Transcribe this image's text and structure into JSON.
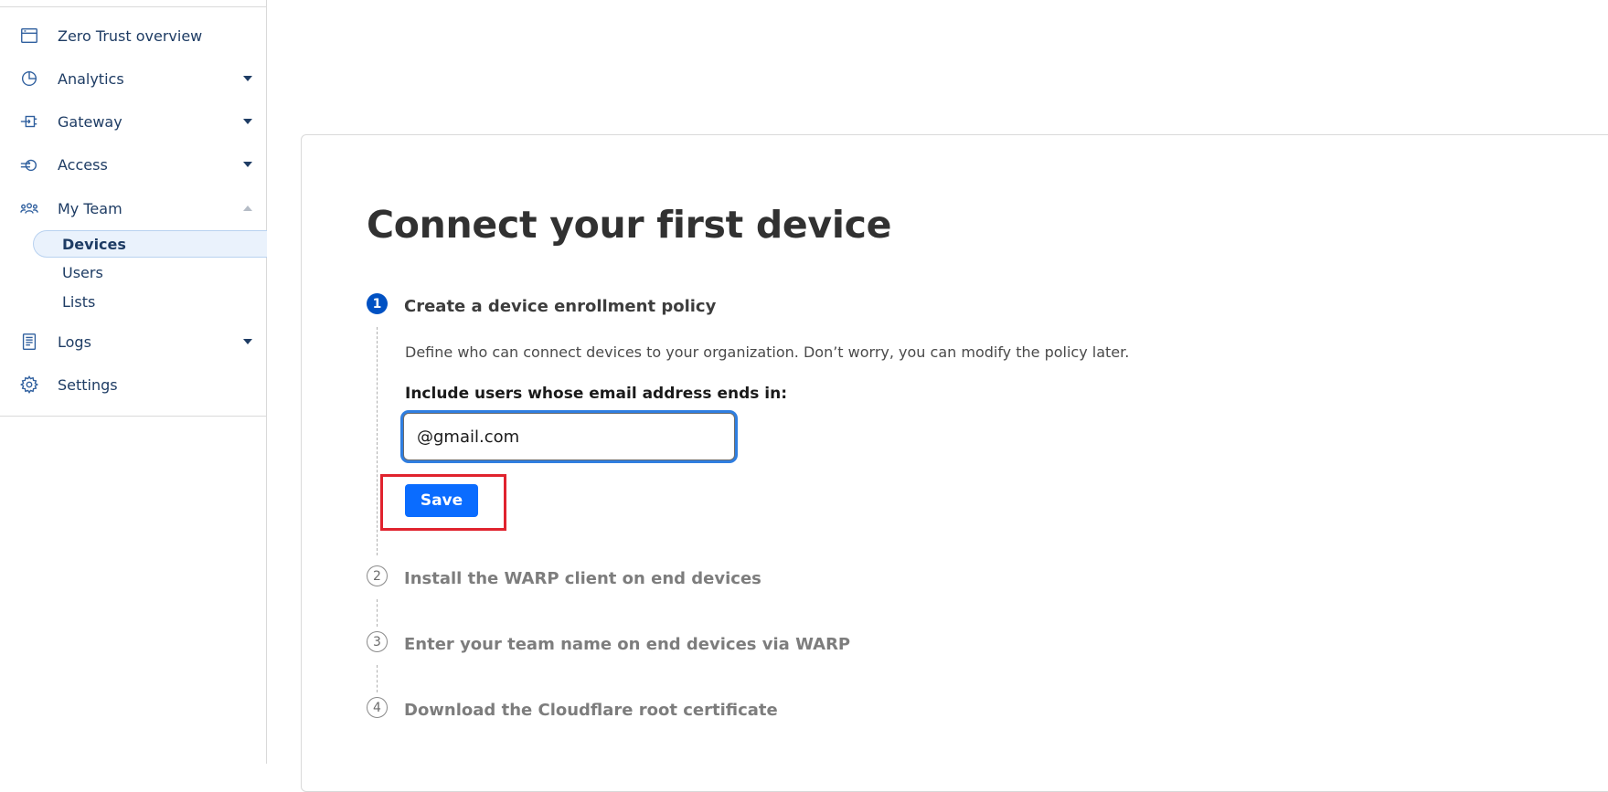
{
  "sidebar": {
    "items": [
      {
        "label": "Zero Trust overview",
        "icon": "browser-window-icon"
      },
      {
        "label": "Analytics",
        "icon": "pie-chart-icon"
      },
      {
        "label": "Gateway",
        "icon": "gateway-icon"
      },
      {
        "label": "Access",
        "icon": "access-icon"
      },
      {
        "label": "My Team",
        "icon": "team-icon"
      },
      {
        "label": "Logs",
        "icon": "logs-icon"
      },
      {
        "label": "Settings",
        "icon": "gear-icon"
      }
    ],
    "my_team_sub": [
      {
        "label": "Devices",
        "active": true
      },
      {
        "label": "Users",
        "active": false
      },
      {
        "label": "Lists",
        "active": false
      }
    ]
  },
  "main": {
    "title": "Connect your first device",
    "steps": [
      {
        "number": "1",
        "title": "Create a device enrollment policy"
      },
      {
        "number": "2",
        "title": "Install the WARP client on end devices"
      },
      {
        "number": "3",
        "title": "Enter your team name on end devices via WARP"
      },
      {
        "number": "4",
        "title": "Download the Cloudflare root certificate"
      }
    ],
    "step1": {
      "description": "Define who can connect devices to your organization. Don’t worry, you can modify the policy later.",
      "field_label": "Include users whose email address ends in:",
      "email_value": "@gmail.com",
      "save_label": "Save"
    }
  },
  "colors": {
    "nav_text": "#1e3c64",
    "accent": "#0051c3",
    "save_button": "#0a6cff",
    "highlight": "#e0232e"
  }
}
